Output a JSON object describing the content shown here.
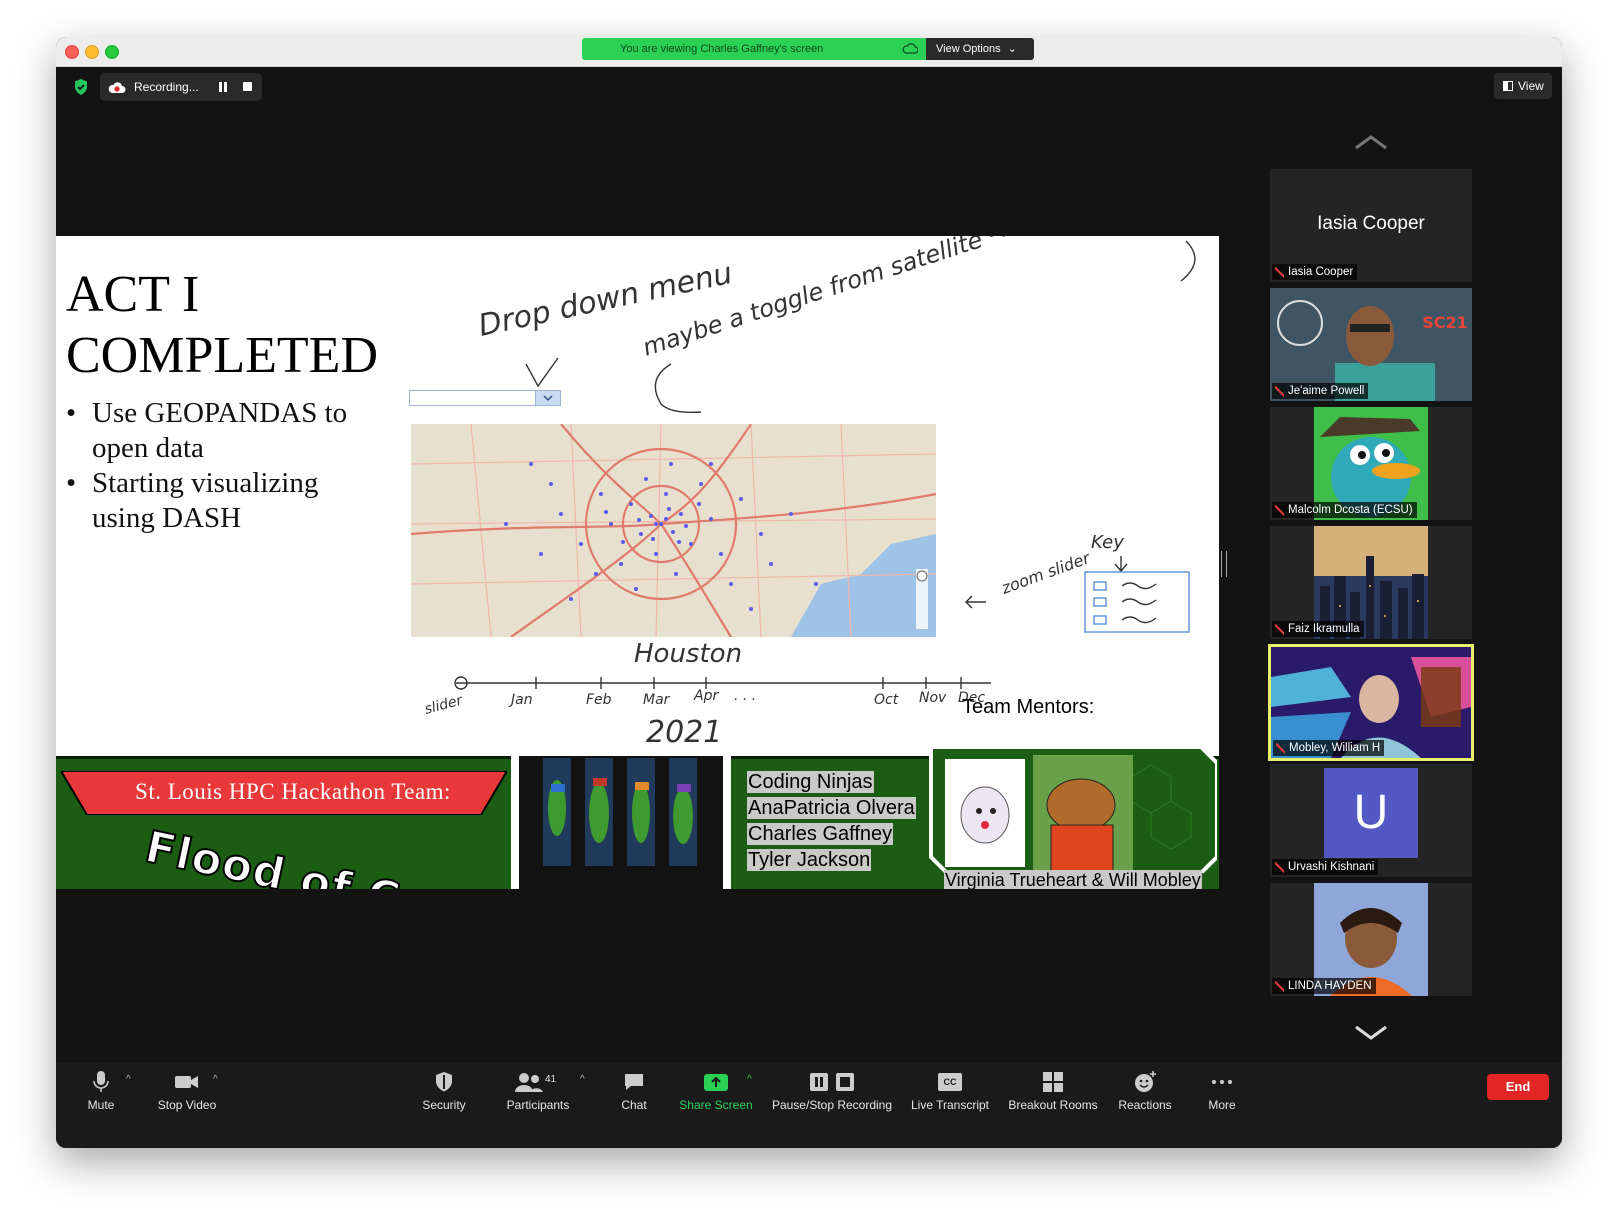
{
  "banner": {
    "viewing": "You are viewing Charles Gaffney's screen",
    "view_options": "View Options"
  },
  "topbar": {
    "recording": "Recording...",
    "view": "View"
  },
  "slide": {
    "title_line1": "ACT I",
    "title_line2": "COMPLETED",
    "bullets": [
      "Use GEOPANDAS to open data",
      "Starting visualizing using DASH"
    ],
    "sketch_notes": {
      "drop_down": "Drop down menu",
      "toggle": "maybe a toggle from satellite → image view",
      "zoom": "zoom slider",
      "key": "Key",
      "city": "Houston",
      "year": "2021",
      "slider": "slider",
      "months": [
        "Jan",
        "Feb",
        "Mar",
        "Apr",
        ". . .",
        "Oct",
        "Nov",
        "Dec"
      ]
    },
    "mentors_label": "Team Mentors:",
    "team_banner": "St. Louis HPC Hackathon Team:",
    "team_name": "Flood of Code",
    "members": [
      "Coding Ninjas",
      "AnaPatricia Olvera",
      "Charles Gaffney",
      "Tyler Jackson"
    ],
    "mentors": "Virginia Trueheart & Will Mobley"
  },
  "participants": [
    {
      "name": "Iasia Cooper",
      "big_name": "Iasia Cooper",
      "type": "name"
    },
    {
      "name": "Je'aime Powell",
      "type": "video"
    },
    {
      "name": "Malcolm Dcosta (ECSU)",
      "type": "avatar"
    },
    {
      "name": "Faiz Ikramulla",
      "type": "image"
    },
    {
      "name": "Mobley, William H",
      "type": "video",
      "active": true
    },
    {
      "name": "Urvashi Kishnani",
      "initial": "U",
      "type": "initial"
    },
    {
      "name": "LINDA HAYDEN",
      "type": "image"
    }
  ],
  "toolbar": {
    "mute": "Mute",
    "stop_video": "Stop Video",
    "security": "Security",
    "participants": "Participants",
    "participants_count": "41",
    "chat": "Chat",
    "share_screen": "Share Screen",
    "pause_stop": "Pause/Stop Recording",
    "live_transcript": "Live Transcript",
    "breakout": "Breakout Rooms",
    "reactions": "Reactions",
    "more": "More",
    "end": "End",
    "cc": "CC"
  },
  "colors": {
    "accent_green": "#2bd155",
    "end_red": "#e22525",
    "active_border": "#e6f06a",
    "team_green": "#1b5d12"
  }
}
